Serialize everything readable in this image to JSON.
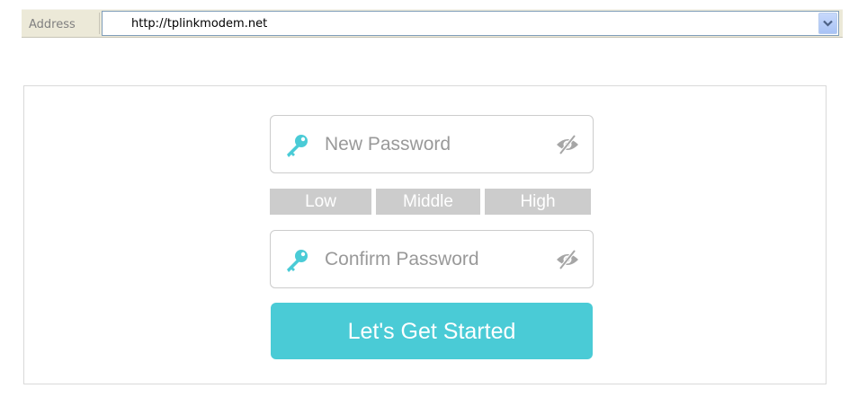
{
  "address_bar": {
    "label": "Address",
    "url": "http://tplinkmodem.net",
    "dropdown_icon": "chevron-down-icon"
  },
  "form": {
    "new_password": {
      "placeholder": "New Password",
      "value": "",
      "icon": "key-icon",
      "toggle_icon": "eye-slash-icon"
    },
    "strength": {
      "levels": [
        "Low",
        "Middle",
        "High"
      ]
    },
    "confirm_password": {
      "placeholder": "Confirm Password",
      "value": "",
      "icon": "key-icon",
      "toggle_icon": "eye-slash-icon"
    },
    "submit_label": "Let's Get Started"
  },
  "colors": {
    "accent": "#4acbd6",
    "key_icon": "#4acbd6",
    "strength_inactive": "#cccccc",
    "eye_icon": "#a6a6a6",
    "placeholder": "#999999"
  }
}
